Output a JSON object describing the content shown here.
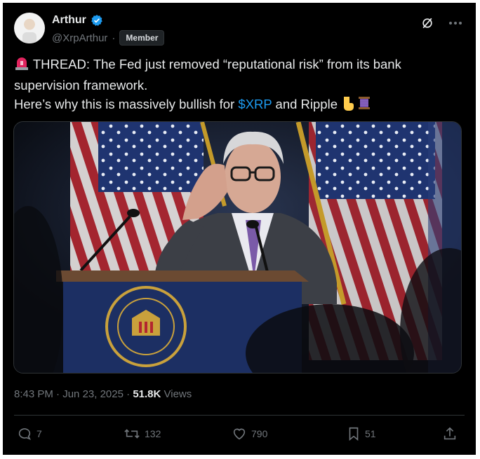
{
  "author": {
    "name": "Arthur",
    "handle": "@XrpArthur",
    "separator": "·",
    "badge": "Member"
  },
  "tweet": {
    "line1_prefix_emoji": "🚨",
    "line1": "THREAD: The Fed just removed “reputational risk” from its bank",
    "line2": "supervision framework.",
    "line3_before": "Here’s why this is massively bullish for ",
    "line3_link": "$XRP",
    "line3_after": " and Ripple ",
    "line3_emojis": "👇🧵"
  },
  "meta": {
    "time": "8:43 PM",
    "dot1": "·",
    "date": "Jun 23, 2025",
    "dot2": "·",
    "views_count": "51.8K",
    "views_label": "Views"
  },
  "actions": {
    "replies": "7",
    "reposts": "132",
    "likes": "790",
    "bookmarks": "51"
  },
  "icons": [
    "grok-icon",
    "more-icon",
    "reply-icon",
    "repost-icon",
    "like-icon",
    "bookmark-icon",
    "share-icon"
  ],
  "colors": {
    "background": "#000000",
    "text": "#e7e9ea",
    "muted": "#71767b",
    "link": "#1d9bf0"
  }
}
